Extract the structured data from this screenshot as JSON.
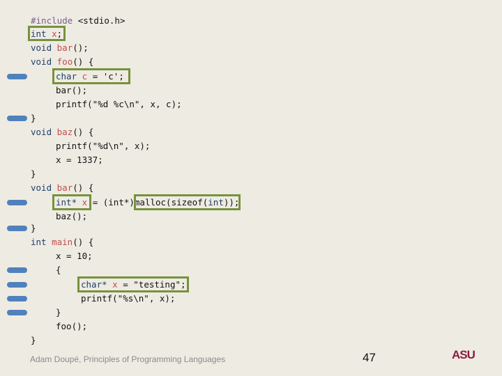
{
  "slide": {
    "code_lines": [
      {
        "indent": 0,
        "tokens": [
          {
            "t": "#include",
            "c": "pp"
          },
          {
            "t": " <stdio.h>",
            "c": ""
          }
        ]
      },
      {
        "indent": 0,
        "tokens": [
          {
            "t": "int",
            "c": "kw"
          },
          {
            "t": " ",
            "c": ""
          },
          {
            "t": "x",
            "c": "id"
          },
          {
            "t": ";",
            "c": ""
          }
        ]
      },
      {
        "indent": 0,
        "tokens": [
          {
            "t": "void",
            "c": "kw"
          },
          {
            "t": " ",
            "c": ""
          },
          {
            "t": "bar",
            "c": "id"
          },
          {
            "t": "();",
            "c": ""
          }
        ]
      },
      {
        "indent": 0,
        "tokens": [
          {
            "t": "void",
            "c": "kw"
          },
          {
            "t": " ",
            "c": ""
          },
          {
            "t": "foo",
            "c": "id"
          },
          {
            "t": "() {",
            "c": ""
          }
        ]
      },
      {
        "indent": 1,
        "tokens": [
          {
            "t": "char",
            "c": "kw"
          },
          {
            "t": " ",
            "c": ""
          },
          {
            "t": "c",
            "c": "id"
          },
          {
            "t": " = 'c';",
            "c": ""
          }
        ]
      },
      {
        "indent": 1,
        "tokens": [
          {
            "t": "bar();",
            "c": ""
          }
        ]
      },
      {
        "indent": 1,
        "tokens": [
          {
            "t": "printf(\"%d %c\\n\", x, c);",
            "c": ""
          }
        ]
      },
      {
        "indent": 0,
        "tokens": [
          {
            "t": "}",
            "c": ""
          }
        ]
      },
      {
        "indent": 0,
        "tokens": [
          {
            "t": "void",
            "c": "kw"
          },
          {
            "t": " ",
            "c": ""
          },
          {
            "t": "baz",
            "c": "id"
          },
          {
            "t": "() {",
            "c": ""
          }
        ]
      },
      {
        "indent": 1,
        "tokens": [
          {
            "t": "printf(\"%d\\n\", x);",
            "c": ""
          }
        ]
      },
      {
        "indent": 1,
        "tokens": [
          {
            "t": "x = 1337;",
            "c": ""
          }
        ]
      },
      {
        "indent": 0,
        "tokens": [
          {
            "t": "}",
            "c": ""
          }
        ]
      },
      {
        "indent": 0,
        "tokens": [
          {
            "t": "void",
            "c": "kw"
          },
          {
            "t": " ",
            "c": ""
          },
          {
            "t": "bar",
            "c": "id"
          },
          {
            "t": "() {",
            "c": ""
          }
        ]
      },
      {
        "indent": 1,
        "tokens": [
          {
            "t": "int*",
            "c": "kw"
          },
          {
            "t": " ",
            "c": ""
          },
          {
            "t": "x",
            "c": "id"
          },
          {
            "t": " = (int*)malloc(sizeof(",
            "c": ""
          },
          {
            "t": "int",
            "c": "kw"
          },
          {
            "t": "));",
            "c": ""
          }
        ]
      },
      {
        "indent": 1,
        "tokens": [
          {
            "t": "baz();",
            "c": ""
          }
        ]
      },
      {
        "indent": 0,
        "tokens": [
          {
            "t": "}",
            "c": ""
          }
        ]
      },
      {
        "indent": 0,
        "tokens": [
          {
            "t": "int",
            "c": "kw"
          },
          {
            "t": " ",
            "c": ""
          },
          {
            "t": "main",
            "c": "id"
          },
          {
            "t": "() {",
            "c": ""
          }
        ]
      },
      {
        "indent": 1,
        "tokens": [
          {
            "t": "x = 10;",
            "c": ""
          }
        ]
      },
      {
        "indent": 1,
        "tokens": [
          {
            "t": "{",
            "c": ""
          }
        ]
      },
      {
        "indent": 2,
        "tokens": [
          {
            "t": "char*",
            "c": "kw"
          },
          {
            "t": " ",
            "c": ""
          },
          {
            "t": "x",
            "c": "id"
          },
          {
            "t": " = \"testing\";",
            "c": ""
          }
        ]
      },
      {
        "indent": 2,
        "tokens": [
          {
            "t": "printf(\"%s\\n\", x);",
            "c": ""
          }
        ]
      },
      {
        "indent": 1,
        "tokens": [
          {
            "t": "}",
            "c": ""
          }
        ]
      },
      {
        "indent": 1,
        "tokens": [
          {
            "t": "foo();",
            "c": ""
          }
        ]
      },
      {
        "indent": 0,
        "tokens": [
          {
            "t": "}",
            "c": ""
          }
        ]
      }
    ],
    "highlight_boxes": [
      {
        "line": 1,
        "label": "int x;"
      },
      {
        "line": 4,
        "label": "char c = 'c';"
      },
      {
        "line": 13,
        "label": "int* x"
      },
      {
        "line": 13,
        "label": "malloc(sizeof(int))"
      },
      {
        "line": 19,
        "label": "char* x = \"testing\";"
      }
    ],
    "marker_lines": [
      4,
      7,
      13,
      15,
      18,
      19,
      20,
      21
    ],
    "footer": {
      "author": "Adam Doupé, Principles of Programming Languages",
      "page_number": "47",
      "logo_text": "ASU"
    },
    "colors": {
      "background": "#eeebe3",
      "keyword": "#1f3f66",
      "identifier": "#c0504d",
      "preprocessor": "#7a5c8e",
      "box_border": "#76923c",
      "marker": "#4f81bd",
      "logo": "#8c1d40"
    }
  }
}
